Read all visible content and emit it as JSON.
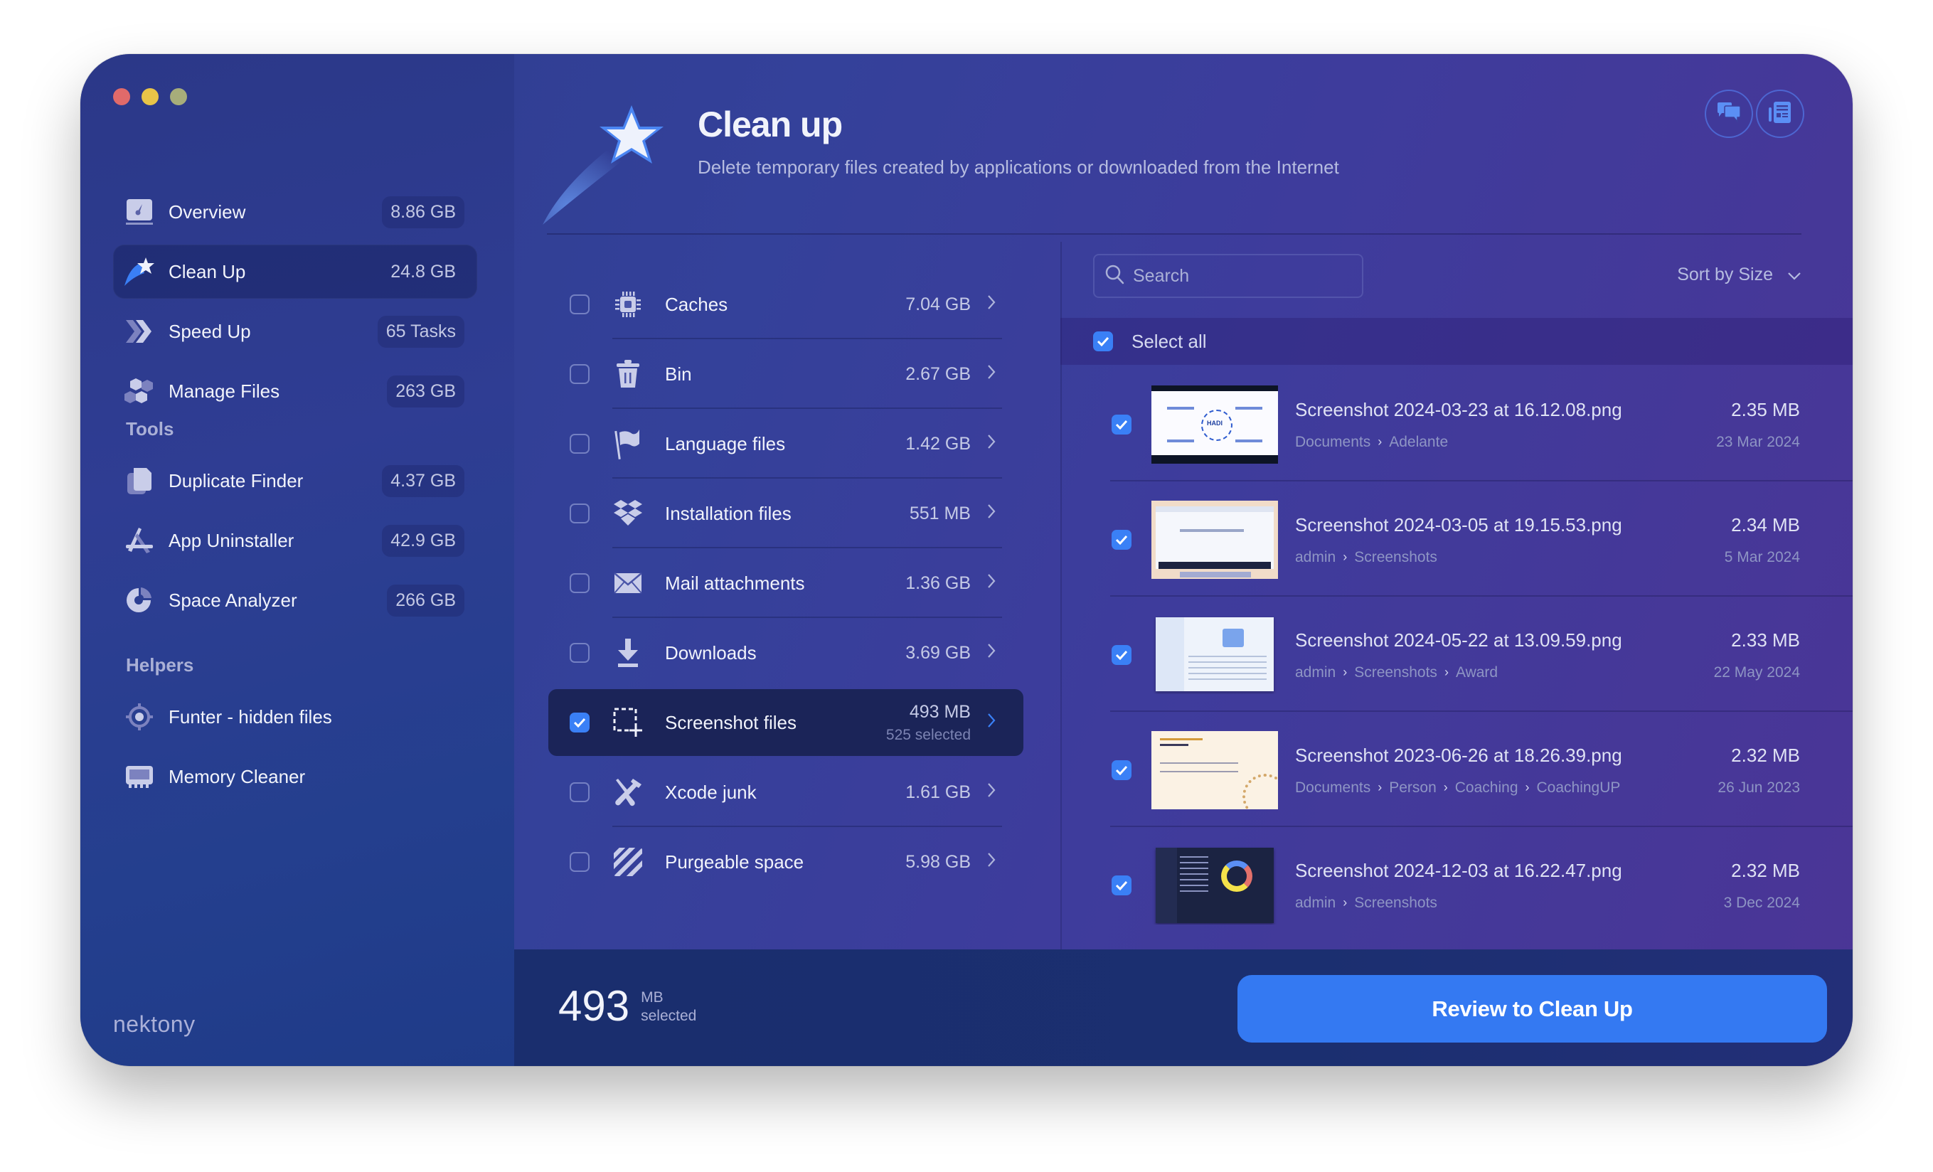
{
  "window": {
    "traffic_lights": [
      "close",
      "minimize",
      "maximize"
    ]
  },
  "sidebar": {
    "items": [
      {
        "label": "Overview",
        "badge": "8.86 GB",
        "icon": "overview-gauge-icon",
        "active": false
      },
      {
        "label": "Clean Up",
        "badge": "24.8 GB",
        "icon": "cleanup-star-icon",
        "active": true
      },
      {
        "label": "Speed Up",
        "badge": "65 Tasks",
        "icon": "speedup-chevrons-icon",
        "active": false
      },
      {
        "label": "Manage Files",
        "badge": "263 GB",
        "icon": "manage-files-hexagons-icon",
        "active": false
      }
    ],
    "tools_title": "Tools",
    "tools": [
      {
        "label": "Duplicate Finder",
        "badge": "4.37 GB",
        "icon": "duplicate-files-icon"
      },
      {
        "label": "App Uninstaller",
        "badge": "42.9 GB",
        "icon": "app-uninstaller-icon"
      },
      {
        "label": "Space Analyzer",
        "badge": "266 GB",
        "icon": "space-analyzer-pie-icon"
      }
    ],
    "helpers_title": "Helpers",
    "helpers": [
      {
        "label": "Funter - hidden files",
        "icon": "funter-target-icon"
      },
      {
        "label": "Memory Cleaner",
        "icon": "memory-chip-icon"
      }
    ],
    "brand": "nektony"
  },
  "header": {
    "title": "Clean up",
    "subtitle": "Delete temporary files created by applications or downloaded from the Internet",
    "buttons": [
      {
        "name": "chat-support-icon"
      },
      {
        "name": "news-icon"
      }
    ]
  },
  "categories": [
    {
      "label": "Caches",
      "size": "7.04 GB",
      "checked": false,
      "icon": "chip-icon"
    },
    {
      "label": "Bin",
      "size": "2.67 GB",
      "checked": false,
      "icon": "trash-icon"
    },
    {
      "label": "Language files",
      "size": "1.42 GB",
      "checked": false,
      "icon": "flag-icon"
    },
    {
      "label": "Installation files",
      "size": "551 MB",
      "checked": false,
      "icon": "dropbox-icon"
    },
    {
      "label": "Mail attachments",
      "size": "1.36 GB",
      "checked": false,
      "icon": "envelope-icon"
    },
    {
      "label": "Downloads",
      "size": "3.69 GB",
      "checked": false,
      "icon": "download-icon"
    },
    {
      "label": "Screenshot files",
      "size": "493 MB",
      "sub": "525 selected",
      "checked": true,
      "active": true,
      "icon": "screenshot-icon"
    },
    {
      "label": "Xcode junk",
      "size": "1.61 GB",
      "checked": false,
      "icon": "hammer-screwdriver-icon"
    },
    {
      "label": "Purgeable space",
      "size": "5.98 GB",
      "checked": false,
      "icon": "purgeable-stripes-icon"
    }
  ],
  "files_panel": {
    "search_placeholder": "Search",
    "search_value": "",
    "sort_label": "Sort by Size",
    "select_all_label": "Select all",
    "select_all_checked": true,
    "files": [
      {
        "name": "Screenshot 2024-03-23 at 16.12.08.png",
        "path": [
          "Documents",
          "Adelante"
        ],
        "size": "2.35 MB",
        "date": "23 Mar 2024",
        "checked": true,
        "thumb": "hadi"
      },
      {
        "name": "Screenshot 2024-03-05 at 19.15.53.png",
        "path": [
          "admin",
          "Screenshots"
        ],
        "size": "2.34 MB",
        "date": "5 Mar 2024",
        "checked": true,
        "thumb": "web"
      },
      {
        "name": "Screenshot 2024-05-22 at 13.09.59.png",
        "path": [
          "admin",
          "Screenshots",
          "Award"
        ],
        "size": "2.33 MB",
        "date": "22 May 2024",
        "checked": true,
        "thumb": "finder"
      },
      {
        "name": "Screenshot 2023-06-26 at 18.26.39.png",
        "path": [
          "Documents",
          "Person",
          "Coaching",
          "CoachingUP"
        ],
        "size": "2.32 MB",
        "date": "26 Jun 2023",
        "checked": true,
        "thumb": "slide"
      },
      {
        "name": "Screenshot 2024-12-03 at 16.22.47.png",
        "path": [
          "admin",
          "Screenshots"
        ],
        "size": "2.32 MB",
        "date": "3 Dec 2024",
        "checked": true,
        "thumb": "dark"
      }
    ]
  },
  "footer": {
    "total_value": "493",
    "total_unit": "MB",
    "total_caption": "selected",
    "cta_label": "Review to Clean Up"
  },
  "colors": {
    "accent": "#3479f2",
    "checkbox_checked": "#3a80f6",
    "close": "#e06a6a",
    "minimize": "#e8c448",
    "maximize": "#a7ad7a"
  }
}
